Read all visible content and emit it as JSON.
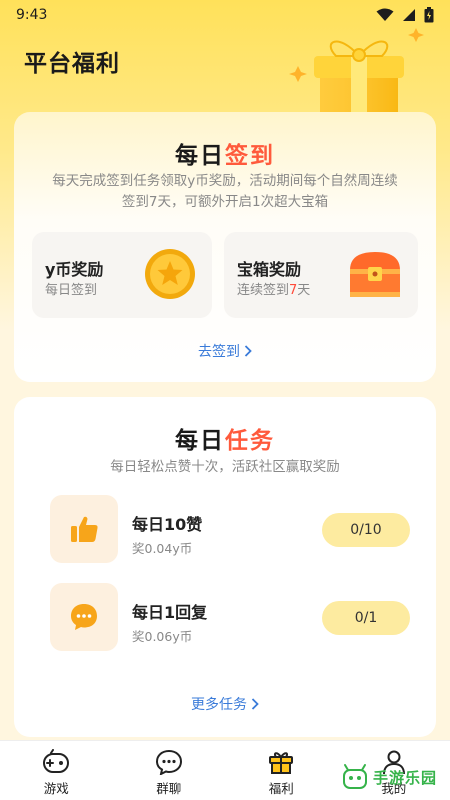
{
  "status_bar": {
    "time": "9:43"
  },
  "page": {
    "title": "平台福利"
  },
  "checkin": {
    "title_prefix": "每日",
    "title_accent": "签到",
    "desc_line1": "每天完成签到任务领取y币奖励，活动期间每个自然周连续",
    "desc_line2": "签到7天，可额外开启1次超大宝箱",
    "coin_reward": {
      "title": "y币奖励",
      "subtitle": "每日签到"
    },
    "chest_reward": {
      "title": "宝箱奖励",
      "subtitle_prefix": "连续签到",
      "days": "7",
      "subtitle_suffix": "天"
    },
    "link": "去签到"
  },
  "tasks": {
    "title_prefix": "每日",
    "title_accent": "任务",
    "desc": "每日轻松点赞十次，活跃社区赢取奖励",
    "items": [
      {
        "name": "每日10赞",
        "reward": "奖0.04y币",
        "progress": "0/10",
        "icon": "thumbs-up-icon"
      },
      {
        "name": "每日1回复",
        "reward": "奖0.06y币",
        "progress": "0/1",
        "icon": "chat-bubble-icon"
      }
    ],
    "link": "更多任务"
  },
  "tabbar": {
    "items": [
      {
        "label": "游戏",
        "icon": "gamepad-icon"
      },
      {
        "label": "群聊",
        "icon": "chat-icon"
      },
      {
        "label": "福利",
        "icon": "gift-icon"
      },
      {
        "label": "我的",
        "icon": "profile-icon"
      }
    ]
  },
  "watermark": {
    "text": "手游乐园"
  },
  "colors": {
    "accent_red": "#ff5a3c",
    "link_blue": "#3a7bd9",
    "gold": "#ffc21a"
  }
}
